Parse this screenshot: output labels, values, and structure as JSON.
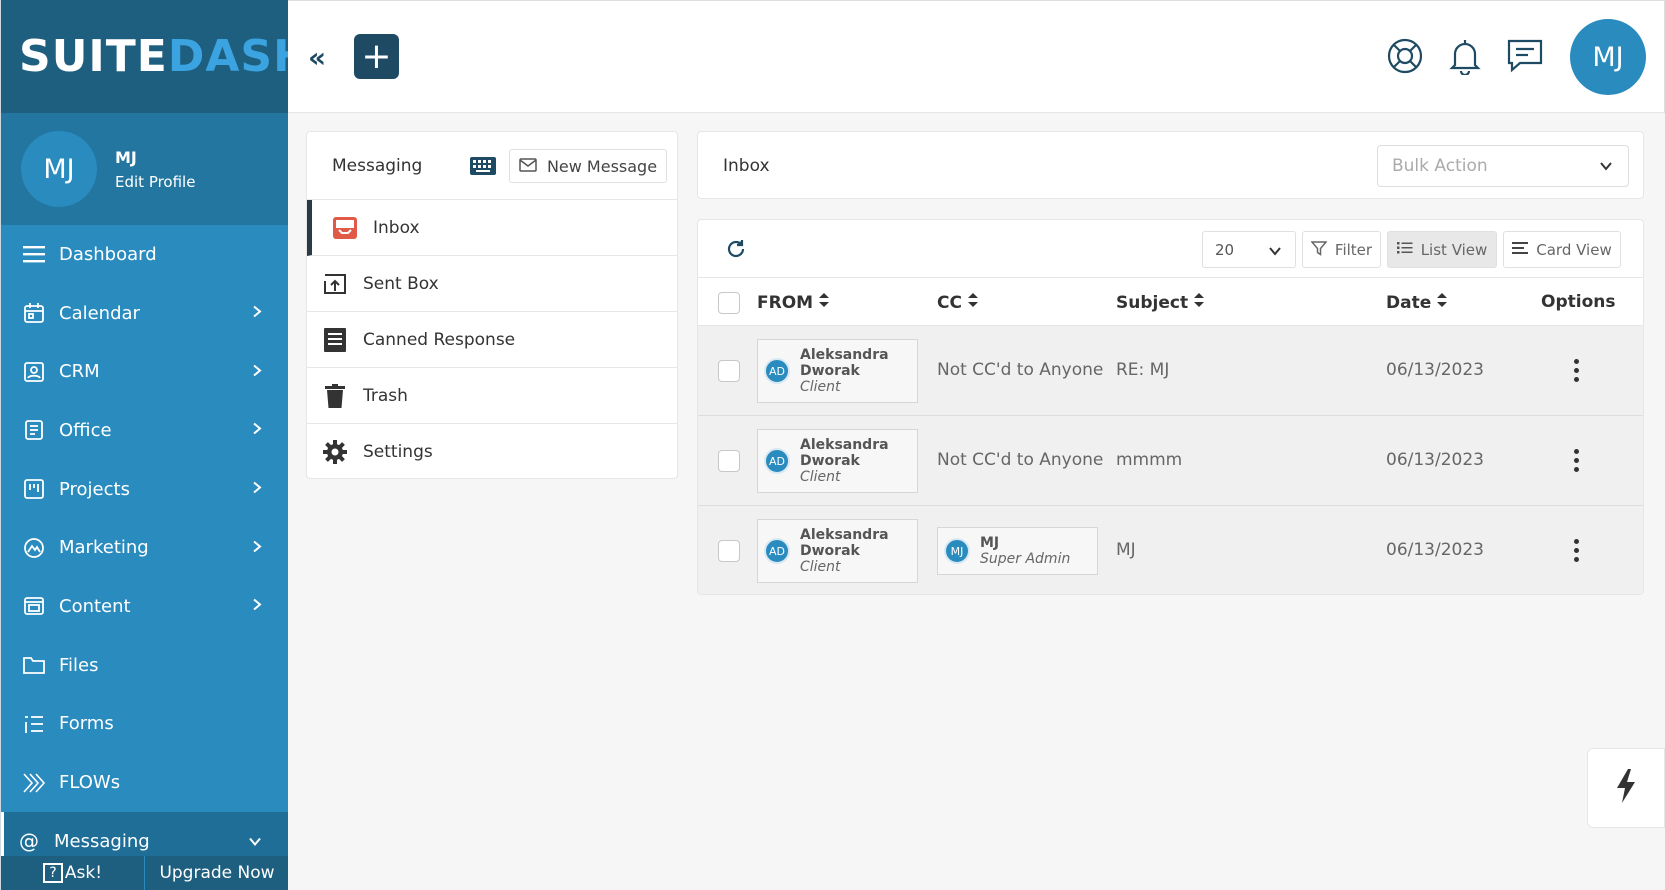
{
  "app": {
    "logo_main": "SUITE",
    "logo_accent": "DASH"
  },
  "profile": {
    "initials": "MJ",
    "name": "MJ",
    "edit_label": "Edit Profile"
  },
  "sidebar": {
    "items": [
      {
        "label": "Dashboard",
        "icon": "list-icon",
        "has_chevron": false
      },
      {
        "label": "Calendar",
        "icon": "calendar-icon",
        "has_chevron": true
      },
      {
        "label": "CRM",
        "icon": "contact-card-icon",
        "has_chevron": true
      },
      {
        "label": "Office",
        "icon": "office-icon",
        "has_chevron": true
      },
      {
        "label": "Projects",
        "icon": "projects-icon",
        "has_chevron": true
      },
      {
        "label": "Marketing",
        "icon": "marketing-icon",
        "has_chevron": true
      },
      {
        "label": "Content",
        "icon": "content-icon",
        "has_chevron": true
      },
      {
        "label": "Files",
        "icon": "folder-icon",
        "has_chevron": false
      },
      {
        "label": "Forms",
        "icon": "forms-icon",
        "has_chevron": false
      },
      {
        "label": "FLOWs",
        "icon": "flows-icon",
        "has_chevron": false
      },
      {
        "label": "Messaging",
        "icon": "at-icon",
        "has_chevron": true,
        "active": true
      }
    ],
    "footer": {
      "ask_label": "Ask!",
      "upgrade_label": "Upgrade Now"
    }
  },
  "header": {
    "avatar_initials": "MJ",
    "icons": [
      "support-icon",
      "bell-icon",
      "chat-icon"
    ]
  },
  "messaging": {
    "title": "Messaging",
    "new_message_label": "New Message",
    "folders": [
      {
        "label": "Inbox",
        "icon": "inbox-icon",
        "active": true
      },
      {
        "label": "Sent Box",
        "icon": "sent-box-icon"
      },
      {
        "label": "Canned Response",
        "icon": "canned-response-icon"
      },
      {
        "label": "Trash",
        "icon": "trash-icon"
      },
      {
        "label": "Settings",
        "icon": "gear-icon"
      }
    ]
  },
  "inbox": {
    "title": "Inbox",
    "bulk_action_placeholder": "Bulk Action",
    "per_page": "20",
    "filter_label": "Filter",
    "list_view_label": "List View",
    "card_view_label": "Card View",
    "columns": {
      "from": "FROM",
      "cc": "CC",
      "subject": "Subject",
      "date": "Date",
      "options": "Options"
    },
    "rows": [
      {
        "from": {
          "initials": "AD",
          "name": "Aleksandra Dworak",
          "role": "Client"
        },
        "cc_text": "Not CC'd to Anyone",
        "subject": "RE: MJ",
        "date": "06/13/2023"
      },
      {
        "from": {
          "initials": "AD",
          "name": "Aleksandra Dworak",
          "role": "Client"
        },
        "cc_text": "Not CC'd to Anyone",
        "subject": "mmmm",
        "date": "06/13/2023"
      },
      {
        "from": {
          "initials": "AD",
          "name": "Aleksandra Dworak",
          "role": "Client"
        },
        "cc": {
          "initials": "MJ",
          "name": "MJ",
          "role": "Super Admin"
        },
        "subject": "MJ",
        "date": "06/13/2023"
      }
    ]
  },
  "colors": {
    "sidebar": "#2a8bbf",
    "sidebar_dark": "#1e5f80",
    "accent_button": "#1e4b63",
    "inbox_icon": "#e05a47"
  }
}
